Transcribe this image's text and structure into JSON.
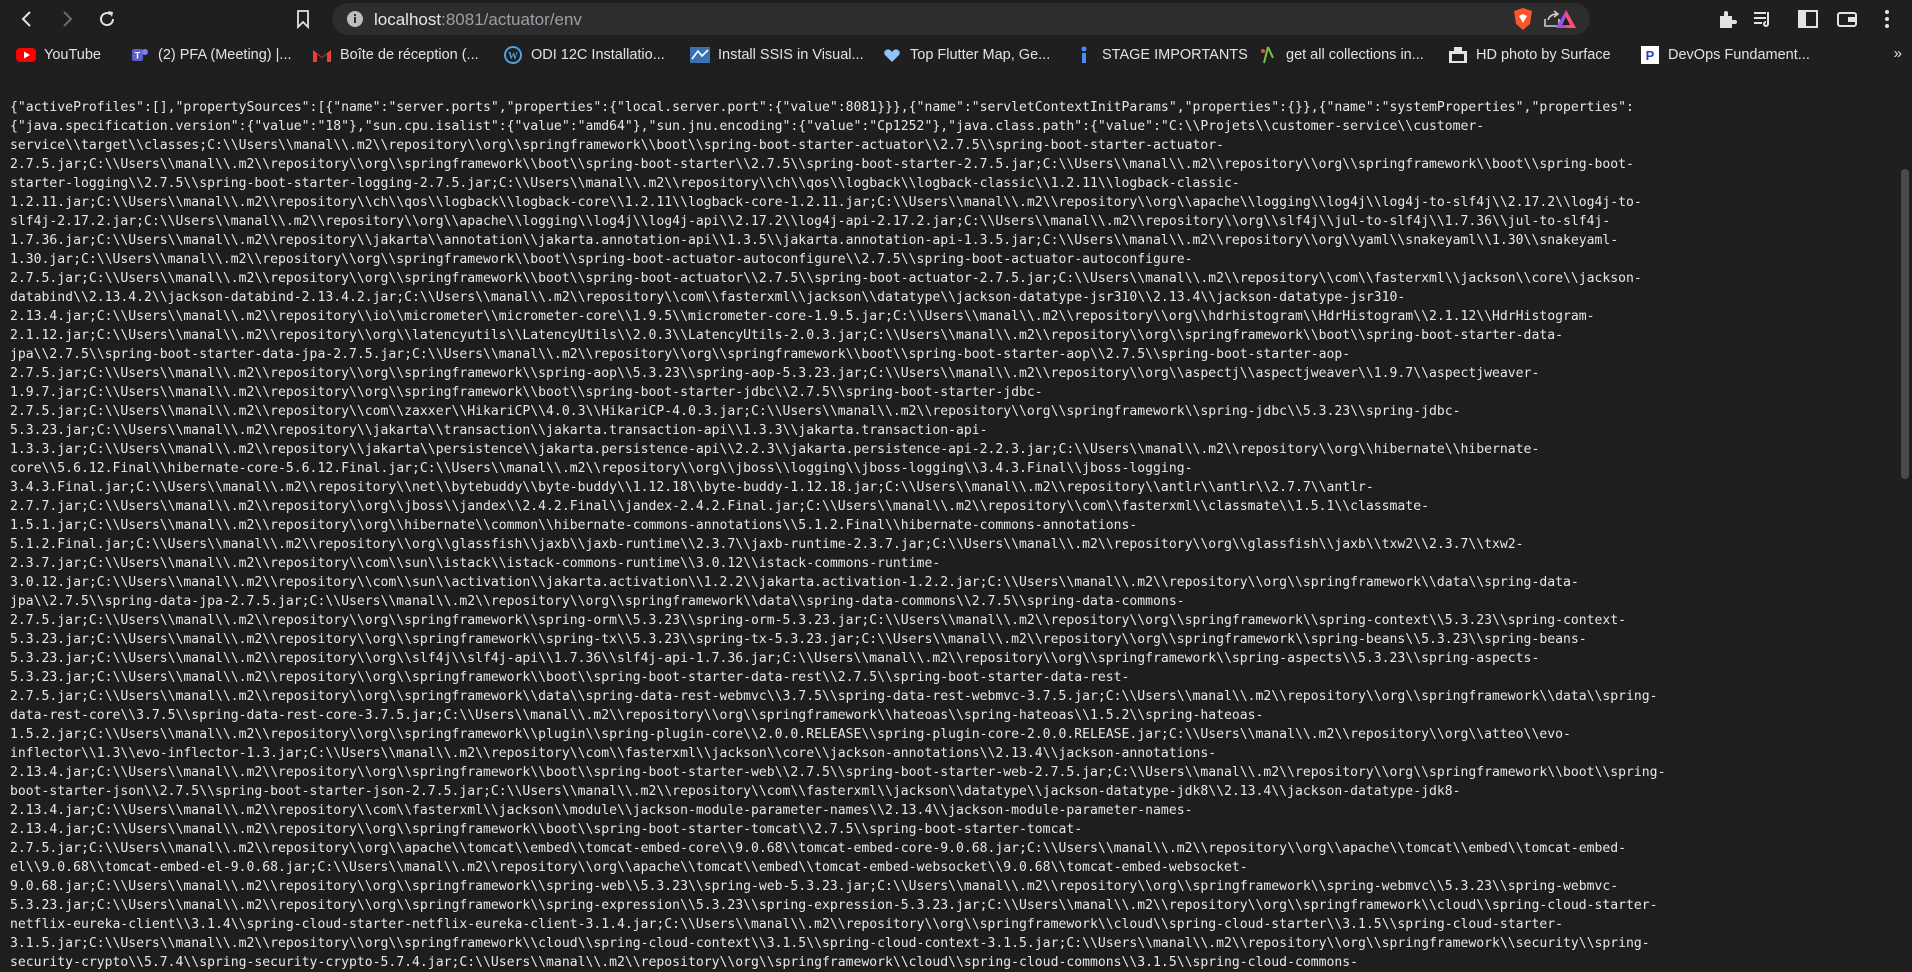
{
  "address_bar": {
    "host": "localhost",
    "port_path": ":8081/actuator/env"
  },
  "bookmarks": [
    {
      "label": "YouTube",
      "icon": "youtube-icon"
    },
    {
      "label": "(2) PFA (Meeting) |...",
      "icon": "teams-icon"
    },
    {
      "label": "Boîte de réception (...",
      "icon": "gmail-icon"
    },
    {
      "label": "ODI 12C Installatio...",
      "icon": "wordpress-icon"
    },
    {
      "label": "Install SSIS in Visual...",
      "icon": "ssis-icon"
    },
    {
      "label": "Top Flutter Map, Ge...",
      "icon": "flutter-icon"
    },
    {
      "label": "STAGE IMPORTANTS",
      "icon": "stage-icon"
    },
    {
      "label": "get all collections in...",
      "icon": "collections-icon"
    },
    {
      "label": "HD photo by Surface",
      "icon": "photo-icon"
    },
    {
      "label": "DevOps Fundament...",
      "icon": "pluralsight-icon"
    }
  ],
  "colors": {
    "toolbar_bg": "#1f1f1f",
    "page_bg": "#1e1e1e",
    "text": "#e8e8e8",
    "brave_orange": "#fb542b",
    "youtube_red": "#ff0000"
  },
  "json_lines": [
    "{\"activeProfiles\":[],\"propertySources\":[{\"name\":\"server.ports\",\"properties\":{\"local.server.port\":{\"value\":8081}}},{\"name\":\"servletContextInitParams\",\"properties\":{}},{\"name\":\"systemProperties\",\"properties\":",
    "{\"java.specification.version\":{\"value\":\"18\"},\"sun.cpu.isalist\":{\"value\":\"amd64\"},\"sun.jnu.encoding\":{\"value\":\"Cp1252\"},\"java.class.path\":{\"value\":\"C:\\\\Projets\\\\customer-service\\\\customer-",
    "service\\\\target\\\\classes;C:\\\\Users\\\\manal\\\\.m2\\\\repository\\\\org\\\\springframework\\\\boot\\\\spring-boot-starter-actuator\\\\2.7.5\\\\spring-boot-starter-actuator-",
    "2.7.5.jar;C:\\\\Users\\\\manal\\\\.m2\\\\repository\\\\org\\\\springframework\\\\boot\\\\spring-boot-starter\\\\2.7.5\\\\spring-boot-starter-2.7.5.jar;C:\\\\Users\\\\manal\\\\.m2\\\\repository\\\\org\\\\springframework\\\\boot\\\\spring-boot-",
    "starter-logging\\\\2.7.5\\\\spring-boot-starter-logging-2.7.5.jar;C:\\\\Users\\\\manal\\\\.m2\\\\repository\\\\ch\\\\qos\\\\logback\\\\logback-classic\\\\1.2.11\\\\logback-classic-",
    "1.2.11.jar;C:\\\\Users\\\\manal\\\\.m2\\\\repository\\\\ch\\\\qos\\\\logback\\\\logback-core\\\\1.2.11\\\\logback-core-1.2.11.jar;C:\\\\Users\\\\manal\\\\.m2\\\\repository\\\\org\\\\apache\\\\logging\\\\log4j\\\\log4j-to-slf4j\\\\2.17.2\\\\log4j-to-",
    "slf4j-2.17.2.jar;C:\\\\Users\\\\manal\\\\.m2\\\\repository\\\\org\\\\apache\\\\logging\\\\log4j\\\\log4j-api\\\\2.17.2\\\\log4j-api-2.17.2.jar;C:\\\\Users\\\\manal\\\\.m2\\\\repository\\\\org\\\\slf4j\\\\jul-to-slf4j\\\\1.7.36\\\\jul-to-slf4j-",
    "1.7.36.jar;C:\\\\Users\\\\manal\\\\.m2\\\\repository\\\\jakarta\\\\annotation\\\\jakarta.annotation-api\\\\1.3.5\\\\jakarta.annotation-api-1.3.5.jar;C:\\\\Users\\\\manal\\\\.m2\\\\repository\\\\org\\\\yaml\\\\snakeyaml\\\\1.30\\\\snakeyaml-",
    "1.30.jar;C:\\\\Users\\\\manal\\\\.m2\\\\repository\\\\org\\\\springframework\\\\boot\\\\spring-boot-actuator-autoconfigure\\\\2.7.5\\\\spring-boot-actuator-autoconfigure-",
    "2.7.5.jar;C:\\\\Users\\\\manal\\\\.m2\\\\repository\\\\org\\\\springframework\\\\boot\\\\spring-boot-actuator\\\\2.7.5\\\\spring-boot-actuator-2.7.5.jar;C:\\\\Users\\\\manal\\\\.m2\\\\repository\\\\com\\\\fasterxml\\\\jackson\\\\core\\\\jackson-",
    "databind\\\\2.13.4.2\\\\jackson-databind-2.13.4.2.jar;C:\\\\Users\\\\manal\\\\.m2\\\\repository\\\\com\\\\fasterxml\\\\jackson\\\\datatype\\\\jackson-datatype-jsr310\\\\2.13.4\\\\jackson-datatype-jsr310-",
    "2.13.4.jar;C:\\\\Users\\\\manal\\\\.m2\\\\repository\\\\io\\\\micrometer\\\\micrometer-core\\\\1.9.5\\\\micrometer-core-1.9.5.jar;C:\\\\Users\\\\manal\\\\.m2\\\\repository\\\\org\\\\hdrhistogram\\\\HdrHistogram\\\\2.1.12\\\\HdrHistogram-",
    "2.1.12.jar;C:\\\\Users\\\\manal\\\\.m2\\\\repository\\\\org\\\\latencyutils\\\\LatencyUtils\\\\2.0.3\\\\LatencyUtils-2.0.3.jar;C:\\\\Users\\\\manal\\\\.m2\\\\repository\\\\org\\\\springframework\\\\boot\\\\spring-boot-starter-data-",
    "jpa\\\\2.7.5\\\\spring-boot-starter-data-jpa-2.7.5.jar;C:\\\\Users\\\\manal\\\\.m2\\\\repository\\\\org\\\\springframework\\\\boot\\\\spring-boot-starter-aop\\\\2.7.5\\\\spring-boot-starter-aop-",
    "2.7.5.jar;C:\\\\Users\\\\manal\\\\.m2\\\\repository\\\\org\\\\springframework\\\\spring-aop\\\\5.3.23\\\\spring-aop-5.3.23.jar;C:\\\\Users\\\\manal\\\\.m2\\\\repository\\\\org\\\\aspectj\\\\aspectjweaver\\\\1.9.7\\\\aspectjweaver-",
    "1.9.7.jar;C:\\\\Users\\\\manal\\\\.m2\\\\repository\\\\org\\\\springframework\\\\boot\\\\spring-boot-starter-jdbc\\\\2.7.5\\\\spring-boot-starter-jdbc-",
    "2.7.5.jar;C:\\\\Users\\\\manal\\\\.m2\\\\repository\\\\com\\\\zaxxer\\\\HikariCP\\\\4.0.3\\\\HikariCP-4.0.3.jar;C:\\\\Users\\\\manal\\\\.m2\\\\repository\\\\org\\\\springframework\\\\spring-jdbc\\\\5.3.23\\\\spring-jdbc-",
    "5.3.23.jar;C:\\\\Users\\\\manal\\\\.m2\\\\repository\\\\jakarta\\\\transaction\\\\jakarta.transaction-api\\\\1.3.3\\\\jakarta.transaction-api-",
    "1.3.3.jar;C:\\\\Users\\\\manal\\\\.m2\\\\repository\\\\jakarta\\\\persistence\\\\jakarta.persistence-api\\\\2.2.3\\\\jakarta.persistence-api-2.2.3.jar;C:\\\\Users\\\\manal\\\\.m2\\\\repository\\\\org\\\\hibernate\\\\hibernate-",
    "core\\\\5.6.12.Final\\\\hibernate-core-5.6.12.Final.jar;C:\\\\Users\\\\manal\\\\.m2\\\\repository\\\\org\\\\jboss\\\\logging\\\\jboss-logging\\\\3.4.3.Final\\\\jboss-logging-",
    "3.4.3.Final.jar;C:\\\\Users\\\\manal\\\\.m2\\\\repository\\\\net\\\\bytebuddy\\\\byte-buddy\\\\1.12.18\\\\byte-buddy-1.12.18.jar;C:\\\\Users\\\\manal\\\\.m2\\\\repository\\\\antlr\\\\antlr\\\\2.7.7\\\\antlr-",
    "2.7.7.jar;C:\\\\Users\\\\manal\\\\.m2\\\\repository\\\\org\\\\jboss\\\\jandex\\\\2.4.2.Final\\\\jandex-2.4.2.Final.jar;C:\\\\Users\\\\manal\\\\.m2\\\\repository\\\\com\\\\fasterxml\\\\classmate\\\\1.5.1\\\\classmate-",
    "1.5.1.jar;C:\\\\Users\\\\manal\\\\.m2\\\\repository\\\\org\\\\hibernate\\\\common\\\\hibernate-commons-annotations\\\\5.1.2.Final\\\\hibernate-commons-annotations-",
    "5.1.2.Final.jar;C:\\\\Users\\\\manal\\\\.m2\\\\repository\\\\org\\\\glassfish\\\\jaxb\\\\jaxb-runtime\\\\2.3.7\\\\jaxb-runtime-2.3.7.jar;C:\\\\Users\\\\manal\\\\.m2\\\\repository\\\\org\\\\glassfish\\\\jaxb\\\\txw2\\\\2.3.7\\\\txw2-",
    "2.3.7.jar;C:\\\\Users\\\\manal\\\\.m2\\\\repository\\\\com\\\\sun\\\\istack\\\\istack-commons-runtime\\\\3.0.12\\\\istack-commons-runtime-",
    "3.0.12.jar;C:\\\\Users\\\\manal\\\\.m2\\\\repository\\\\com\\\\sun\\\\activation\\\\jakarta.activation\\\\1.2.2\\\\jakarta.activation-1.2.2.jar;C:\\\\Users\\\\manal\\\\.m2\\\\repository\\\\org\\\\springframework\\\\data\\\\spring-data-",
    "jpa\\\\2.7.5\\\\spring-data-jpa-2.7.5.jar;C:\\\\Users\\\\manal\\\\.m2\\\\repository\\\\org\\\\springframework\\\\data\\\\spring-data-commons\\\\2.7.5\\\\spring-data-commons-",
    "2.7.5.jar;C:\\\\Users\\\\manal\\\\.m2\\\\repository\\\\org\\\\springframework\\\\spring-orm\\\\5.3.23\\\\spring-orm-5.3.23.jar;C:\\\\Users\\\\manal\\\\.m2\\\\repository\\\\org\\\\springframework\\\\spring-context\\\\5.3.23\\\\spring-context-",
    "5.3.23.jar;C:\\\\Users\\\\manal\\\\.m2\\\\repository\\\\org\\\\springframework\\\\spring-tx\\\\5.3.23\\\\spring-tx-5.3.23.jar;C:\\\\Users\\\\manal\\\\.m2\\\\repository\\\\org\\\\springframework\\\\spring-beans\\\\5.3.23\\\\spring-beans-",
    "5.3.23.jar;C:\\\\Users\\\\manal\\\\.m2\\\\repository\\\\org\\\\slf4j\\\\slf4j-api\\\\1.7.36\\\\slf4j-api-1.7.36.jar;C:\\\\Users\\\\manal\\\\.m2\\\\repository\\\\org\\\\springframework\\\\spring-aspects\\\\5.3.23\\\\spring-aspects-",
    "5.3.23.jar;C:\\\\Users\\\\manal\\\\.m2\\\\repository\\\\org\\\\springframework\\\\boot\\\\spring-boot-starter-data-rest\\\\2.7.5\\\\spring-boot-starter-data-rest-",
    "2.7.5.jar;C:\\\\Users\\\\manal\\\\.m2\\\\repository\\\\org\\\\springframework\\\\data\\\\spring-data-rest-webmvc\\\\3.7.5\\\\spring-data-rest-webmvc-3.7.5.jar;C:\\\\Users\\\\manal\\\\.m2\\\\repository\\\\org\\\\springframework\\\\data\\\\spring-",
    "data-rest-core\\\\3.7.5\\\\spring-data-rest-core-3.7.5.jar;C:\\\\Users\\\\manal\\\\.m2\\\\repository\\\\org\\\\springframework\\\\hateoas\\\\spring-hateoas\\\\1.5.2\\\\spring-hateoas-",
    "1.5.2.jar;C:\\\\Users\\\\manal\\\\.m2\\\\repository\\\\org\\\\springframework\\\\plugin\\\\spring-plugin-core\\\\2.0.0.RELEASE\\\\spring-plugin-core-2.0.0.RELEASE.jar;C:\\\\Users\\\\manal\\\\.m2\\\\repository\\\\org\\\\atteo\\\\evo-",
    "inflector\\\\1.3\\\\evo-inflector-1.3.jar;C:\\\\Users\\\\manal\\\\.m2\\\\repository\\\\com\\\\fasterxml\\\\jackson\\\\core\\\\jackson-annotations\\\\2.13.4\\\\jackson-annotations-",
    "2.13.4.jar;C:\\\\Users\\\\manal\\\\.m2\\\\repository\\\\org\\\\springframework\\\\boot\\\\spring-boot-starter-web\\\\2.7.5\\\\spring-boot-starter-web-2.7.5.jar;C:\\\\Users\\\\manal\\\\.m2\\\\repository\\\\org\\\\springframework\\\\boot\\\\spring-",
    "boot-starter-json\\\\2.7.5\\\\spring-boot-starter-json-2.7.5.jar;C:\\\\Users\\\\manal\\\\.m2\\\\repository\\\\com\\\\fasterxml\\\\jackson\\\\datatype\\\\jackson-datatype-jdk8\\\\2.13.4\\\\jackson-datatype-jdk8-",
    "2.13.4.jar;C:\\\\Users\\\\manal\\\\.m2\\\\repository\\\\com\\\\fasterxml\\\\jackson\\\\module\\\\jackson-module-parameter-names\\\\2.13.4\\\\jackson-module-parameter-names-",
    "2.13.4.jar;C:\\\\Users\\\\manal\\\\.m2\\\\repository\\\\org\\\\springframework\\\\boot\\\\spring-boot-starter-tomcat\\\\2.7.5\\\\spring-boot-starter-tomcat-",
    "2.7.5.jar;C:\\\\Users\\\\manal\\\\.m2\\\\repository\\\\org\\\\apache\\\\tomcat\\\\embed\\\\tomcat-embed-core\\\\9.0.68\\\\tomcat-embed-core-9.0.68.jar;C:\\\\Users\\\\manal\\\\.m2\\\\repository\\\\org\\\\apache\\\\tomcat\\\\embed\\\\tomcat-embed-",
    "el\\\\9.0.68\\\\tomcat-embed-el-9.0.68.jar;C:\\\\Users\\\\manal\\\\.m2\\\\repository\\\\org\\\\apache\\\\tomcat\\\\embed\\\\tomcat-embed-websocket\\\\9.0.68\\\\tomcat-embed-websocket-",
    "9.0.68.jar;C:\\\\Users\\\\manal\\\\.m2\\\\repository\\\\org\\\\springframework\\\\spring-web\\\\5.3.23\\\\spring-web-5.3.23.jar;C:\\\\Users\\\\manal\\\\.m2\\\\repository\\\\org\\\\springframework\\\\spring-webmvc\\\\5.3.23\\\\spring-webmvc-",
    "5.3.23.jar;C:\\\\Users\\\\manal\\\\.m2\\\\repository\\\\org\\\\springframework\\\\spring-expression\\\\5.3.23\\\\spring-expression-5.3.23.jar;C:\\\\Users\\\\manal\\\\.m2\\\\repository\\\\org\\\\springframework\\\\cloud\\\\spring-cloud-starter-",
    "netflix-eureka-client\\\\3.1.4\\\\spring-cloud-starter-netflix-eureka-client-3.1.4.jar;C:\\\\Users\\\\manal\\\\.m2\\\\repository\\\\org\\\\springframework\\\\cloud\\\\spring-cloud-starter\\\\3.1.5\\\\spring-cloud-starter-",
    "3.1.5.jar;C:\\\\Users\\\\manal\\\\.m2\\\\repository\\\\org\\\\springframework\\\\cloud\\\\spring-cloud-context\\\\3.1.5\\\\spring-cloud-context-3.1.5.jar;C:\\\\Users\\\\manal\\\\.m2\\\\repository\\\\org\\\\springframework\\\\security\\\\spring-",
    "security-crypto\\\\5.7.4\\\\spring-security-crypto-5.7.4.jar;C:\\\\Users\\\\manal\\\\.m2\\\\repository\\\\org\\\\springframework\\\\cloud\\\\spring-cloud-commons\\\\3.1.5\\\\spring-cloud-commons-"
  ]
}
